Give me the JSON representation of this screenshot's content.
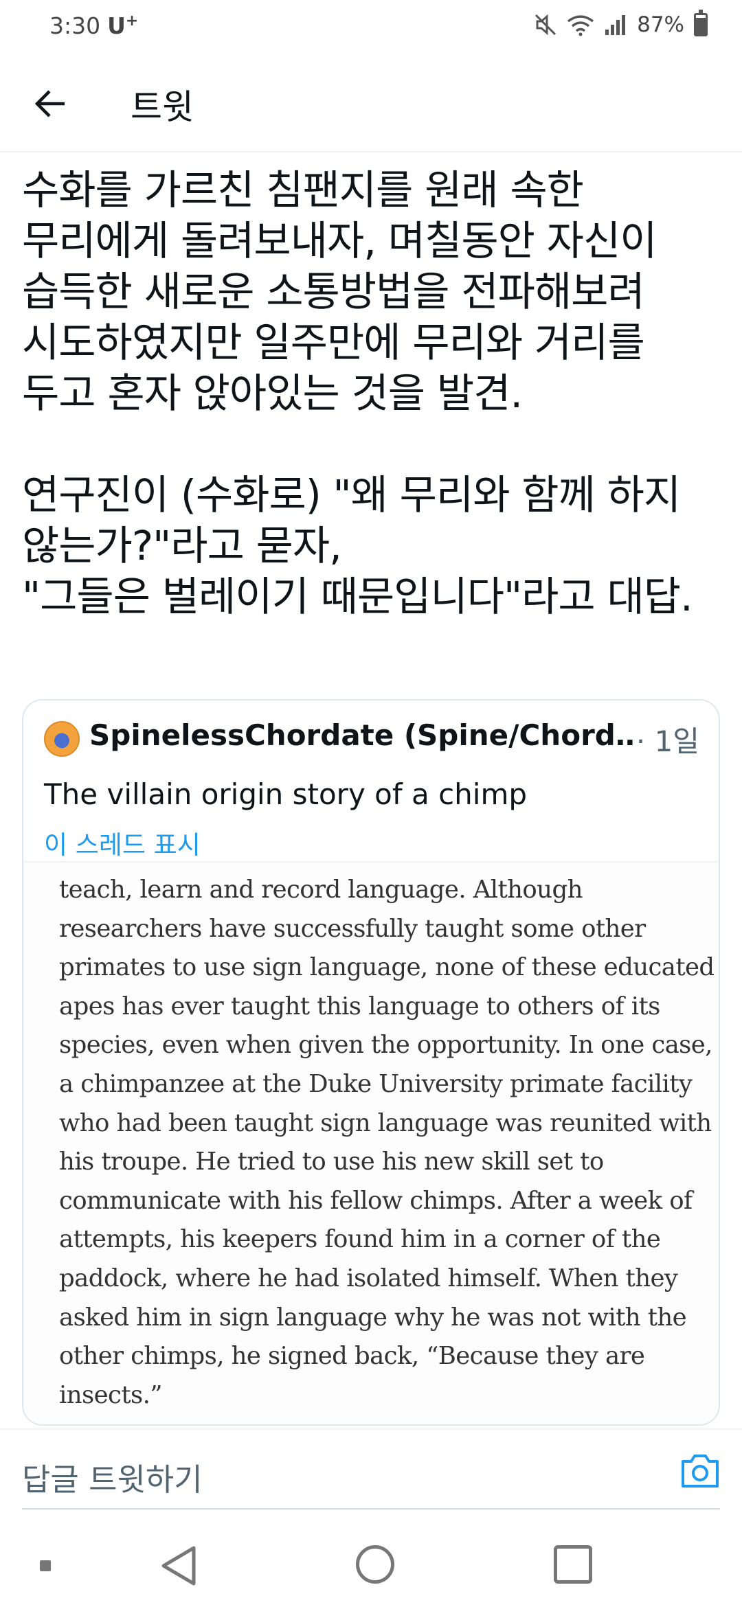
{
  "status_bar": {
    "time": "3:30",
    "carrier": "U",
    "carrier_sup": "+",
    "battery_text": "87%",
    "battery_level": 0.87,
    "icons": [
      "mute-icon",
      "wifi-icon",
      "signal-icon",
      "battery-icon"
    ]
  },
  "header": {
    "back_icon": "arrow-left-icon",
    "title": "트윗"
  },
  "tweet": {
    "paragraph1": "수화를 가르친 침팬지를 원래 속한\n무리에게 돌려보내자, 며칠동안 자신이\n습득한 새로운 소통방법을 전파해보려\n시도하였지만 일주만에 무리와 거리를\n두고 혼자 앉아있는 것을 발견.",
    "paragraph2": "연구진이 (수화로) \"왜 무리와 함께 하지\n않는가?\"라고 묻자,\n\"그들은 벌레이기 때문입니다\"라고 대답."
  },
  "quote": {
    "author": "SpinelessChordate (Spine/Chordat…",
    "meta": "· 1일",
    "body": "The villain origin story of a chimp",
    "thread_link": "이 스레드 표시",
    "image_lines": [
      "teach, learn and record language. Although",
      "researchers have successfully taught some other",
      "primates to use sign language, none of these educated",
      "apes has ever taught this language to others of its",
      "species, even when given the opportunity. In one case,",
      "a chimpanzee at the Duke University primate facility",
      "who had been taught sign language was reunited with",
      "his troupe. He tried to use his new skill set to",
      "communicate with his fellow chimps. After a week of",
      "attempts, his keepers found him in a corner of the",
      "paddock, where he had isolated himself. When they",
      "asked him in sign language why he was not with the",
      "other chimps, he signed back, “Because they are",
      "insects.”"
    ]
  },
  "reply": {
    "placeholder": "답글 트윗하기",
    "camera_icon": "camera-icon"
  },
  "nav": {
    "icons": [
      "menu-dot-icon",
      "back-triangle-icon",
      "home-circle-icon",
      "recents-square-icon"
    ]
  },
  "colors": {
    "accent": "#1d9bf0",
    "text": "#0f1419",
    "secondary": "#536471",
    "border": "#e1e8ed"
  }
}
